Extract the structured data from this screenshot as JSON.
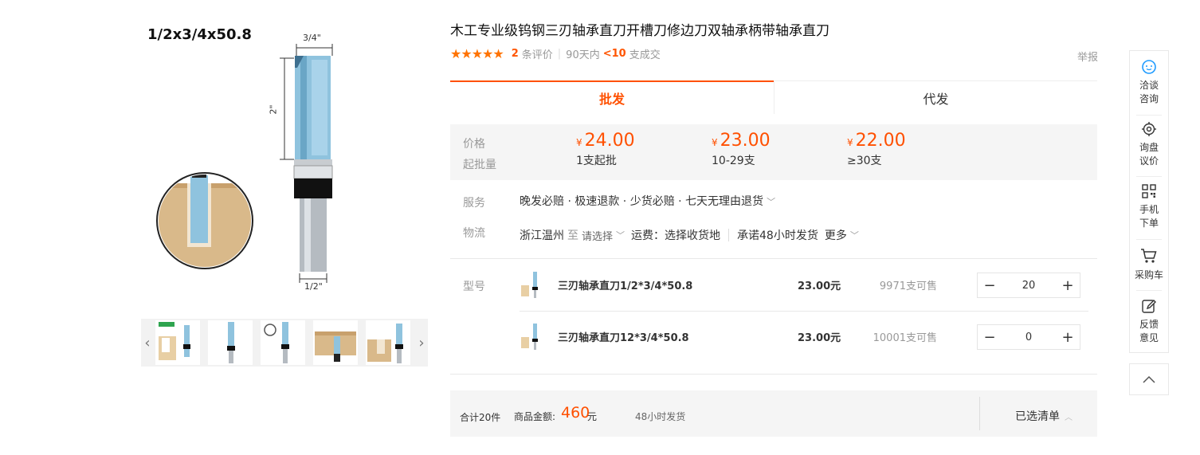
{
  "gallery": {
    "label": "1/2x3/4x50.8",
    "dim_top": "3/4\"",
    "dim_side": "2\"",
    "dim_bottom": "1/2\""
  },
  "product": {
    "title": "木工专业级钨钢三刃轴承直刀开槽刀修边刀双轴承柄带轴承直刀",
    "rating_count": "2",
    "rating_label": "条评价",
    "sales_period": "90天内",
    "sales_count": "<10",
    "sales_label": "支成交",
    "report": "举报",
    "stars": 5
  },
  "tabs": [
    {
      "label": "批发",
      "active": true
    },
    {
      "label": "代发",
      "active": false
    }
  ],
  "price_block": {
    "price_label": "价格",
    "min_label": "起批量",
    "currency": "¥",
    "tiers": [
      {
        "price": "24.00",
        "min": "1支起批"
      },
      {
        "price": "23.00",
        "min": "10-29支"
      },
      {
        "price": "22.00",
        "min": "≥30支"
      }
    ]
  },
  "service": {
    "label": "服务",
    "text": "晚发必赔 · 极速退款 · 少货必赔 · 七天无理由退货"
  },
  "logistics": {
    "label": "物流",
    "origin": "浙江温州",
    "to": "至",
    "select": "请选择",
    "fee": "运费：选择收货地",
    "promise": "承诺48小时发货",
    "more": "更多"
  },
  "sku": {
    "label": "型号",
    "rows": [
      {
        "name": "三刃轴承直刀1/2*3/4*50.8",
        "price": "23.00元",
        "stock": "9971支可售",
        "qty": "20"
      },
      {
        "name": "三刃轴承直刀12*3/4*50.8",
        "price": "23.00元",
        "stock": "10001支可售",
        "qty": "0"
      }
    ]
  },
  "summary": {
    "count": "合计20件",
    "amount_label": "商品金额:",
    "amount": "460",
    "unit": "元",
    "ship": "48小时发货",
    "list": "已选清单"
  },
  "float_bar": [
    {
      "icon": "chat-icon",
      "line1": "洽谈",
      "line2": "咨询"
    },
    {
      "icon": "target-icon",
      "line1": "询盘",
      "line2": "议价"
    },
    {
      "icon": "qrcode-icon",
      "line1": "手机",
      "line2": "下单"
    },
    {
      "icon": "cart-icon",
      "line1": "采购车",
      "line2": ""
    },
    {
      "icon": "edit-icon",
      "line1": "反馈",
      "line2": "意见"
    }
  ],
  "colors": {
    "accent": "#ff5000",
    "star": "#ff7300",
    "bit_blue": "#8fc3de",
    "wood": "#d9b98a"
  }
}
